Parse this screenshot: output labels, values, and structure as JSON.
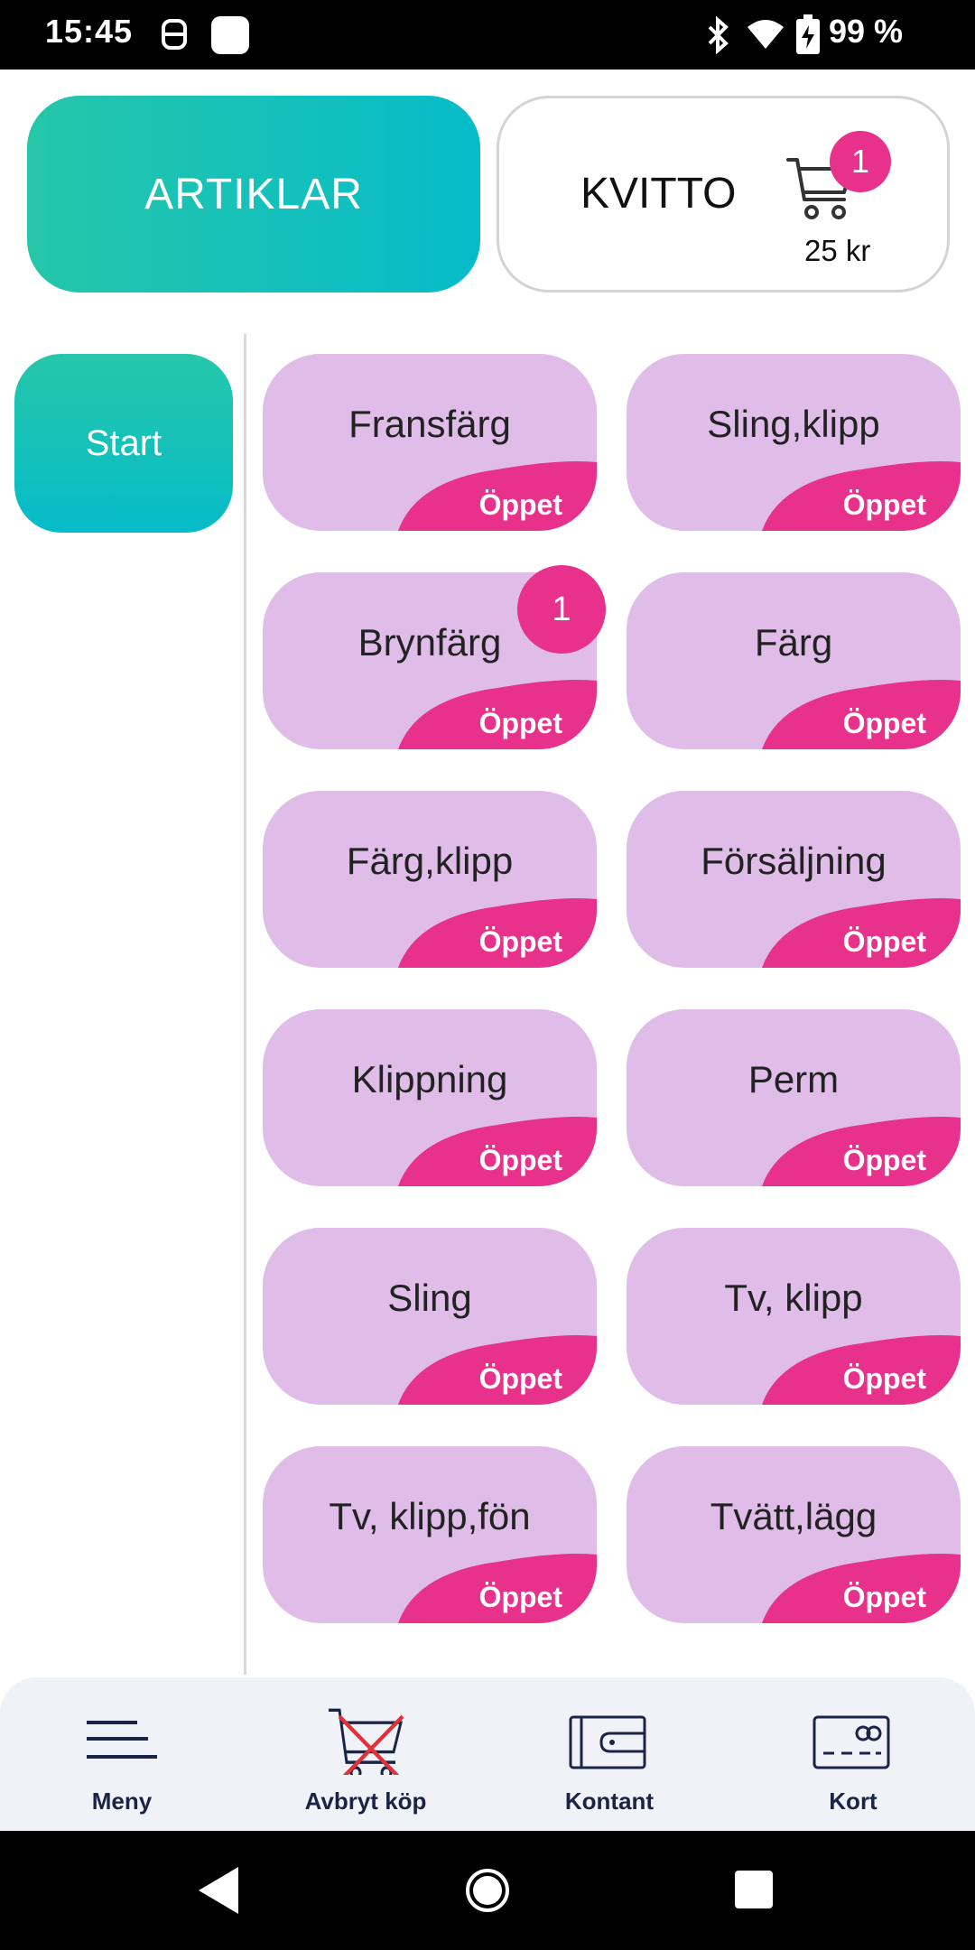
{
  "status_bar": {
    "time": "15:45",
    "battery": "99 %"
  },
  "header": {
    "artiklar_label": "ARTIKLAR",
    "kvitto_label": "KVITTO",
    "cart_count": "1",
    "cart_total": "25 kr"
  },
  "sidebar": {
    "start_label": "Start"
  },
  "colors": {
    "accent_teal": "#06bcc9",
    "tile_bg": "#dfbde8",
    "badge_pink": "#e8318a",
    "nav_text": "#1b2446"
  },
  "tiles": [
    {
      "label": "Fransfärg",
      "tag": "Öppet"
    },
    {
      "label": "Sling,klipp",
      "tag": "Öppet"
    },
    {
      "label": "Brynfärg",
      "tag": "Öppet",
      "badge": "1"
    },
    {
      "label": "Färg",
      "tag": "Öppet"
    },
    {
      "label": "Färg,klipp",
      "tag": "Öppet"
    },
    {
      "label": "Försäljning",
      "tag": "Öppet"
    },
    {
      "label": "Klippning",
      "tag": "Öppet"
    },
    {
      "label": "Perm",
      "tag": "Öppet"
    },
    {
      "label": "Sling",
      "tag": "Öppet"
    },
    {
      "label": "Tv, klipp",
      "tag": "Öppet"
    },
    {
      "label": "Tv, klipp,fön",
      "tag": "Öppet"
    },
    {
      "label": "Tvätt,lägg",
      "tag": "Öppet"
    }
  ],
  "bottom_nav": {
    "items": [
      {
        "label": "Meny",
        "icon": "menu-icon"
      },
      {
        "label": "Avbryt köp",
        "icon": "cancel-cart-icon"
      },
      {
        "label": "Kontant",
        "icon": "wallet-icon"
      },
      {
        "label": "Kort",
        "icon": "card-icon"
      }
    ]
  }
}
